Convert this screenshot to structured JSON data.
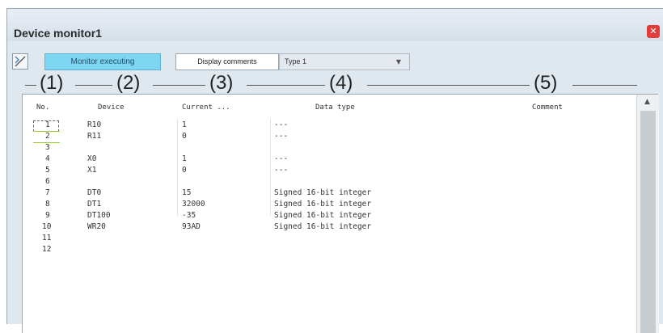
{
  "window": {
    "title": "Device monitor1",
    "close_icon": "close-icon"
  },
  "toolbar": {
    "tool_icon": "monitor-toggle-icon",
    "status": "Monitor executing",
    "display_button": "Display comments",
    "type_select": "Type 1"
  },
  "callouts": [
    "(1)",
    "(2)",
    "(3)",
    "(4)",
    "(5)"
  ],
  "columns": {
    "no": "No.",
    "device": "Device",
    "current": "Current ...",
    "data_type": "Data type",
    "comment": "Comment"
  },
  "rows": [
    {
      "no": "1",
      "device": "R10",
      "current": "1",
      "type": "---"
    },
    {
      "no": "2",
      "device": "R11",
      "current": "0",
      "type": "---"
    },
    {
      "no": "3",
      "device": "",
      "current": "",
      "type": ""
    },
    {
      "no": "4",
      "device": "X0",
      "current": "1",
      "type": "---"
    },
    {
      "no": "5",
      "device": "X1",
      "current": "0",
      "type": "---"
    },
    {
      "no": "6",
      "device": "",
      "current": "",
      "type": ""
    },
    {
      "no": "7",
      "device": "DT0",
      "current": "15",
      "type": "Signed 16-bit integer"
    },
    {
      "no": "8",
      "device": "DT1",
      "current": "32000",
      "type": "Signed 16-bit integer"
    },
    {
      "no": "9",
      "device": "DT100",
      "current": "-35",
      "type": "Signed 16-bit integer"
    },
    {
      "no": "10",
      "device": "WR20",
      "current": "93AD",
      "type": "Signed 16-bit integer"
    },
    {
      "no": "11",
      "device": "",
      "current": "",
      "type": ""
    },
    {
      "no": "12",
      "device": "",
      "current": "",
      "type": ""
    }
  ],
  "colors": {
    "status_bg": "#7dd6f2",
    "close": "#e43b3b",
    "highlight_line": "#9acd32"
  }
}
